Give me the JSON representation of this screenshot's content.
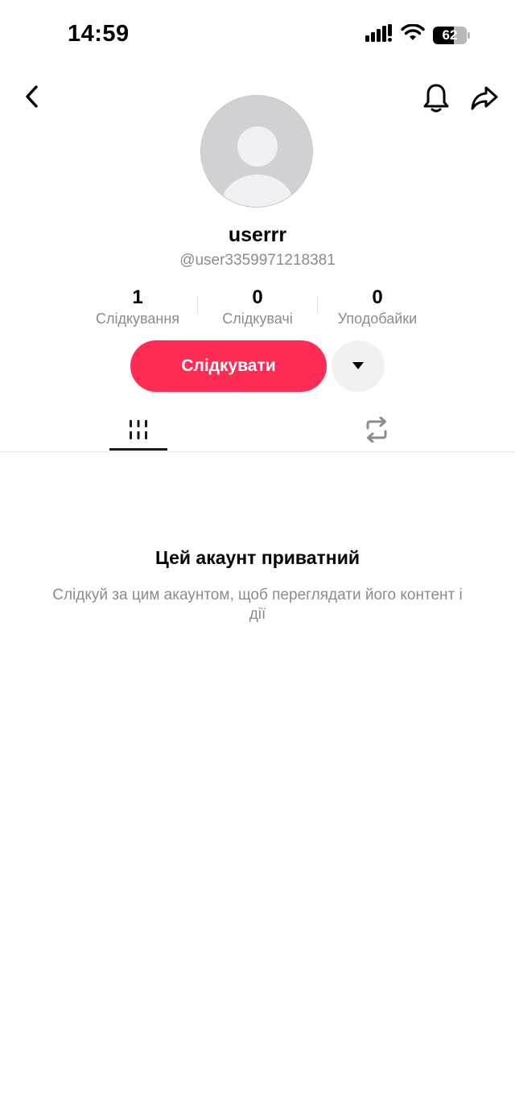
{
  "status_bar": {
    "time": "14:59",
    "battery": "62",
    "icons": [
      "signal-icon",
      "wifi-icon",
      "battery-icon"
    ]
  },
  "header": {
    "icons": [
      "back-icon",
      "bell-icon",
      "share-icon"
    ]
  },
  "profile": {
    "display_name": "userrr",
    "handle": "@user3359971218381",
    "avatar_icon": "default-avatar-icon"
  },
  "stats": [
    {
      "value": "1",
      "label": "Слідкування"
    },
    {
      "value": "0",
      "label": "Слідкувачі"
    },
    {
      "value": "0",
      "label": "Уподобайки"
    }
  ],
  "actions": {
    "follow_label": "Слідкувати",
    "more_icon": "caret-down-icon"
  },
  "tabs": [
    {
      "icon": "videos-grid-icon",
      "active": true
    },
    {
      "icon": "repost-icon",
      "active": false
    }
  ],
  "private_notice": {
    "title": "Цей акаунт приватний",
    "description": "Слідкуй за цим акаунтом, щоб переглядати його контент і дії"
  },
  "colors": {
    "accent": "#fe2c55",
    "text_primary": "#161823",
    "text_secondary": "#8a8b91"
  }
}
